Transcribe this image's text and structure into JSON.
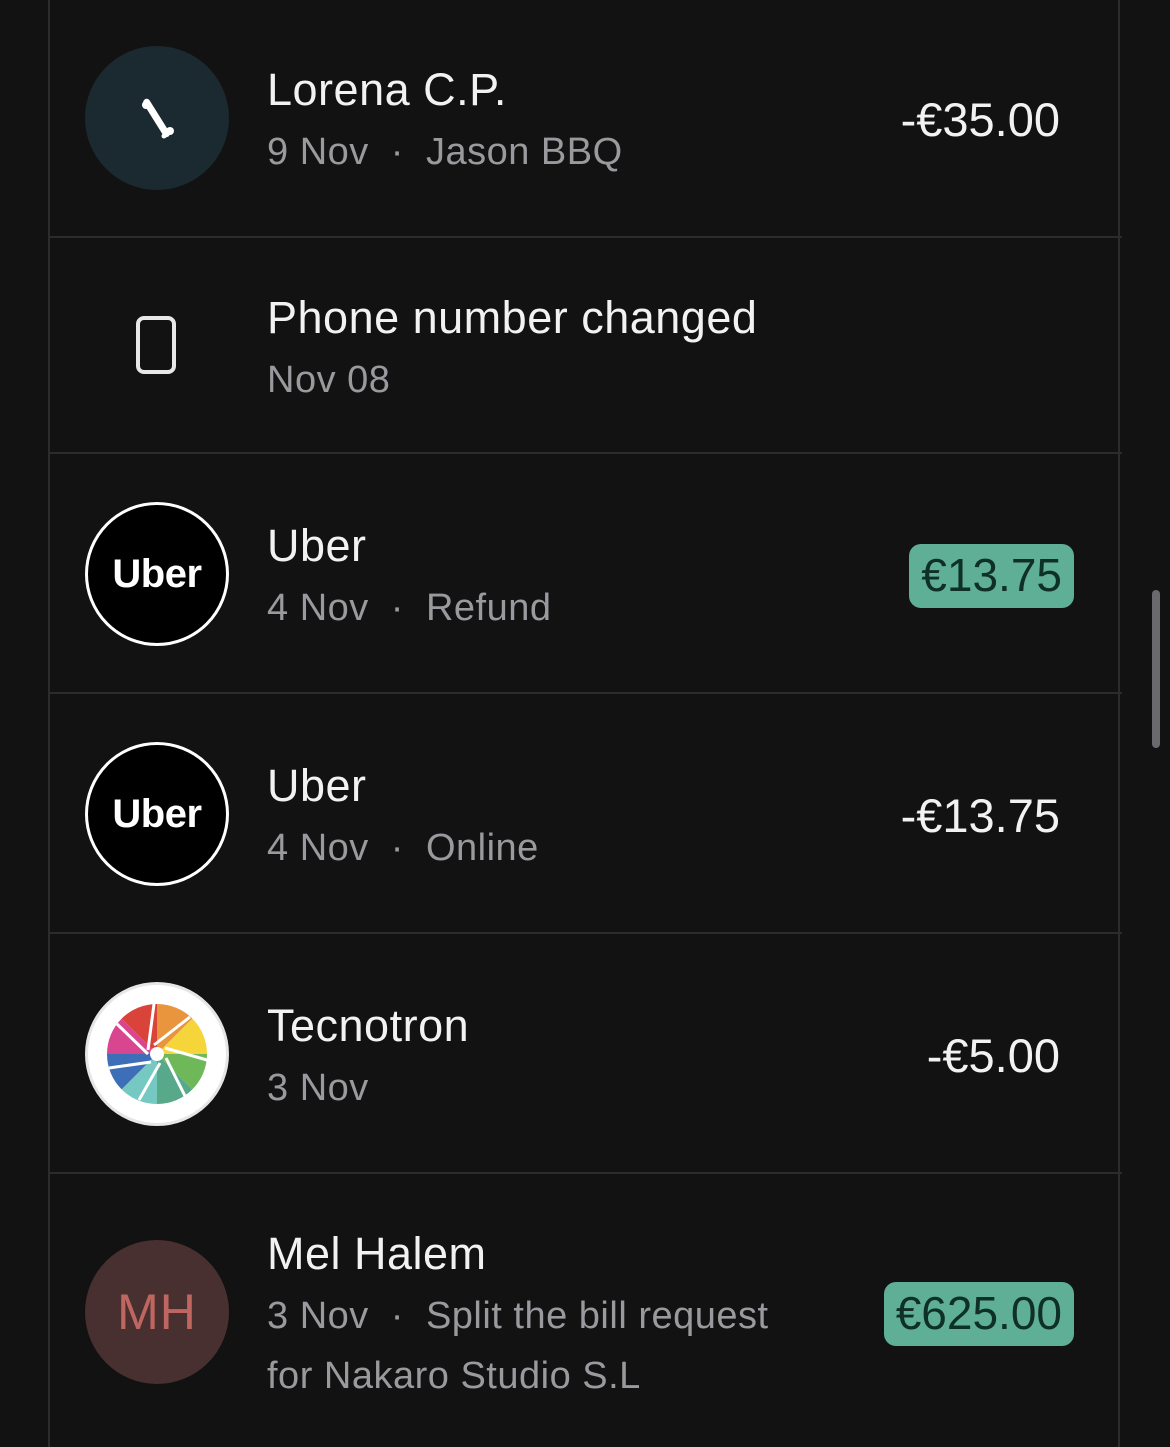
{
  "transactions": [
    {
      "title": "Lorena C.P.",
      "date": "9 Nov",
      "detail": "Jason BBQ",
      "amount": "-€35.00",
      "avatar_icon": "percent-split-icon"
    },
    {
      "title": "Phone number changed",
      "date": "Nov 08",
      "avatar_icon": "phone-icon"
    },
    {
      "title": "Uber",
      "date": "4 Nov",
      "detail": "Refund",
      "amount": "€13.75",
      "avatar_text": "Uber"
    },
    {
      "title": "Uber",
      "date": "4 Nov",
      "detail": "Online",
      "amount": "-€13.75",
      "avatar_text": "Uber"
    },
    {
      "title": "Tecnotron",
      "date": "3 Nov",
      "amount": "-€5.00",
      "avatar_icon": "aperture-logo-icon"
    },
    {
      "title": "Mel Halem",
      "date": "3 Nov",
      "detail_line1": "Split the bill request",
      "detail_line2": "for Nakaro Studio S.L",
      "amount": "€625.00",
      "avatar_text": "MH"
    }
  ],
  "colors": {
    "background": "#121212",
    "positive_badge": "#5fae96",
    "positive_text": "#0f3026",
    "divider": "#2c2c2e"
  }
}
